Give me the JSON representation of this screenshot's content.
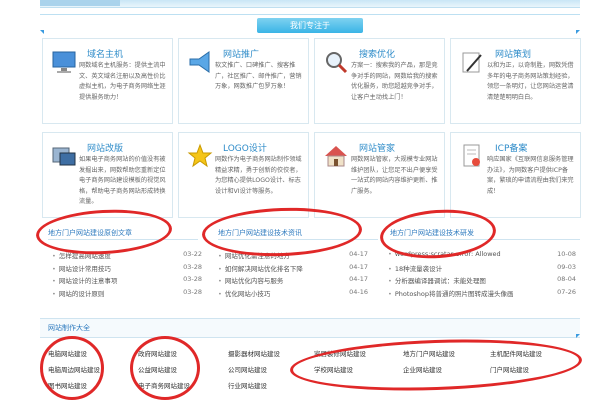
{
  "header": {
    "band_title": "我们专注于"
  },
  "services": [
    {
      "title": "域名主机",
      "desc": "网数域名主机服务：提供主流中文、英文域名注册以及高性价比虚拟主机，为电子商务网络生涯提供服务助力！",
      "icon": "monitor-icon",
      "color": "#3a7fc4"
    },
    {
      "title": "网站推广",
      "desc": "软文推广、口碑推广、搜客推广，社区推广、邮件推广，营销万象，网数推广包罗万象！",
      "icon": "megaphone-icon",
      "color": "#3a7fc4"
    },
    {
      "title": "搜索优化",
      "desc": "方案一：搜索我的产品，那是竞争对手的网站，网数给我的搜索优化服务，助您超越竞争对手，让客户主动找上门！",
      "icon": "magnifier-icon",
      "color": "#3a7fc4"
    },
    {
      "title": "网站策划",
      "desc": "以和为正，以奇制胜，网数凭借多年的电子商务网站策划经验，领您一条明灯，让您网站运营清清楚楚明明白白。",
      "icon": "pencil-icon",
      "color": "#3a7fc4"
    },
    {
      "title": "网站改版",
      "desc": "如果电子商务网站的价值没有被发掘出来，网数帮助您重新定位电子商务网站建设模板的视觉风格，帮助电子商务网站形成转换流量。",
      "icon": "window-icon",
      "color": "#3a7fc4"
    },
    {
      "title": "LOGO设计",
      "desc": "网数作为电子商务网站制作领域精益求精，勇于创新的佼佼者，为您精心提供LOGO设计、标志设计和VI设计等服务。",
      "icon": "star-icon",
      "color": "#3a7fc4"
    },
    {
      "title": "网站管家",
      "desc": "网数网站管家，大规模专业网站维护团队，让您足不出户便享受一站式的网站内容维护更新、推广服务。",
      "icon": "house-icon",
      "color": "#3a7fc4"
    },
    {
      "title": "ICP备案",
      "desc": "响应国家《互联网信息服务管理办法》，为网数客户提供ICP备案，繁琐的申请流程由我们来完成！",
      "icon": "document-icon",
      "color": "#3a7fc4"
    }
  ],
  "sections": [
    {
      "title": "地方门户网站建设原创文章"
    },
    {
      "title": "地方门户网站建设技术资讯"
    },
    {
      "title": "地方门户网站建设技术研发"
    }
  ],
  "articles_left": [
    {
      "text": "怎样提高网站速度",
      "date": "03-22"
    },
    {
      "text": "网站设计常用技巧",
      "date": "03-28"
    },
    {
      "text": "网站设计的注意事项",
      "date": "03-28"
    },
    {
      "text": "网站的设计原则",
      "date": "03-28"
    }
  ],
  "articles_mid": [
    {
      "text": "网站优化需注意的地方",
      "date": "04-17"
    },
    {
      "text": "如何解决网站优化排名下降",
      "date": "04-17"
    },
    {
      "text": "网站优化内容与服务",
      "date": "04-17"
    },
    {
      "text": "优化网站小技巧",
      "date": "04-16"
    }
  ],
  "articles_right": [
    {
      "text": "wordpress:scratar error: Allowed",
      "date": "10-08"
    },
    {
      "text": "18种流量袭设计",
      "date": "09-03"
    },
    {
      "text": "分析器编译器调试：未能处理图",
      "date": "08-04"
    },
    {
      "text": "Photoshop将普通的照片图转成漫头像画",
      "date": "07-26"
    }
  ],
  "categories": {
    "title": "网站制作大全",
    "items": [
      [
        "电脑网站建设",
        "政府网站建设",
        "摄影器材网站建设",
        "家居装修网站建设",
        "地方门户网站建设",
        "主机配件网站建设"
      ],
      [
        "电脑周边网站建设",
        "公益网站建设",
        "公司网站建设",
        "学校网站建设",
        "企业网站建设",
        "门户网站建设"
      ],
      [
        "图书网站建设",
        "电子商务网站建设",
        "行业网站建设"
      ]
    ]
  },
  "annotation_color": "#e02828",
  "accent_color": "#3ab4e6"
}
